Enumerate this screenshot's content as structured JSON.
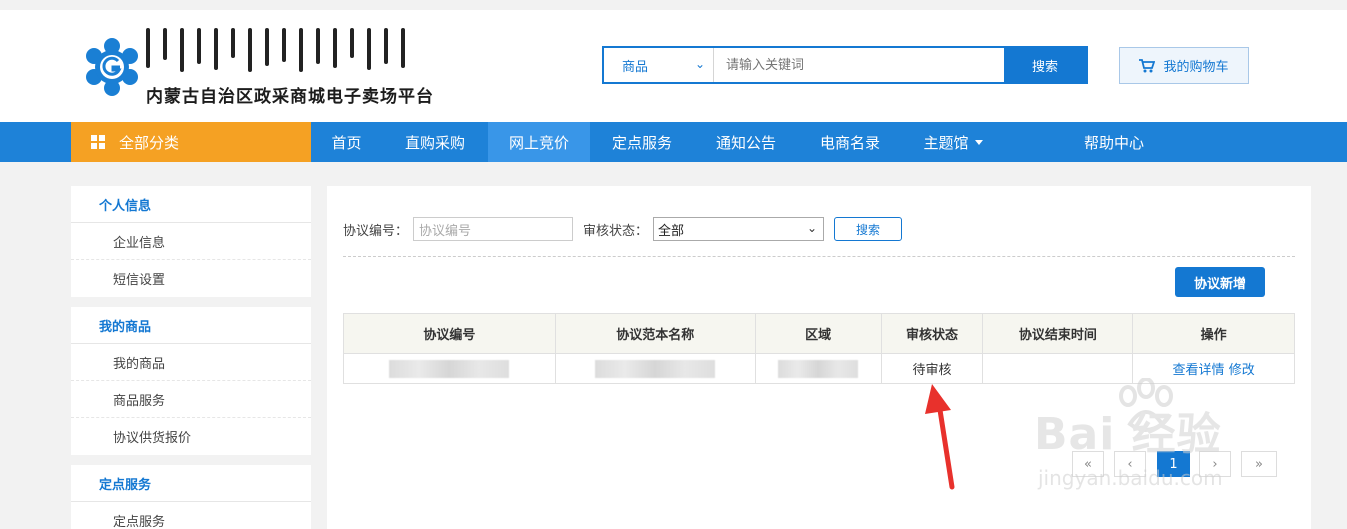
{
  "header": {
    "logo_text": "内蒙古自治区政采商城电子卖场平台",
    "search": {
      "category": "商品",
      "placeholder": "请输入关键词",
      "button": "搜索"
    },
    "cart_label": "我的购物车"
  },
  "nav": {
    "all_categories": "全部分类",
    "items": [
      "首页",
      "直购采购",
      "网上竞价",
      "定点服务",
      "通知公告",
      "电商名录",
      "主题馆",
      "帮助中心"
    ],
    "active": "网上竞价"
  },
  "sidebar": {
    "groups": [
      {
        "title": "个人信息",
        "items": [
          "企业信息",
          "短信设置"
        ]
      },
      {
        "title": "我的商品",
        "items": [
          "我的商品",
          "商品服务",
          "协议供货报价"
        ]
      },
      {
        "title": "定点服务",
        "items": [
          "定点服务"
        ]
      }
    ]
  },
  "filters": {
    "agreement_no_label": "协议编号：",
    "agreement_no_placeholder": "协议编号",
    "status_label": "审核状态：",
    "status_value": "全部",
    "search_button": "搜索"
  },
  "add_button": "协议新增",
  "table": {
    "headers": [
      "协议编号",
      "协议范本名称",
      "区域",
      "审核状态",
      "协议结束时间",
      "操作"
    ],
    "rows": [
      {
        "status": "待审核",
        "end_time": "",
        "actions": [
          "查看详情",
          "修改"
        ]
      }
    ]
  },
  "pagination": {
    "first": "«",
    "prev": "‹",
    "current": "1",
    "next": "›",
    "last": "»"
  },
  "watermark": {
    "main": "Bai  经验",
    "sub": "jingyan.baidu.com"
  },
  "colors": {
    "brand_blue": "#1478d2",
    "nav_blue": "#1e82d8",
    "orange": "#f5a123",
    "arrow_red": "#e8312c"
  }
}
